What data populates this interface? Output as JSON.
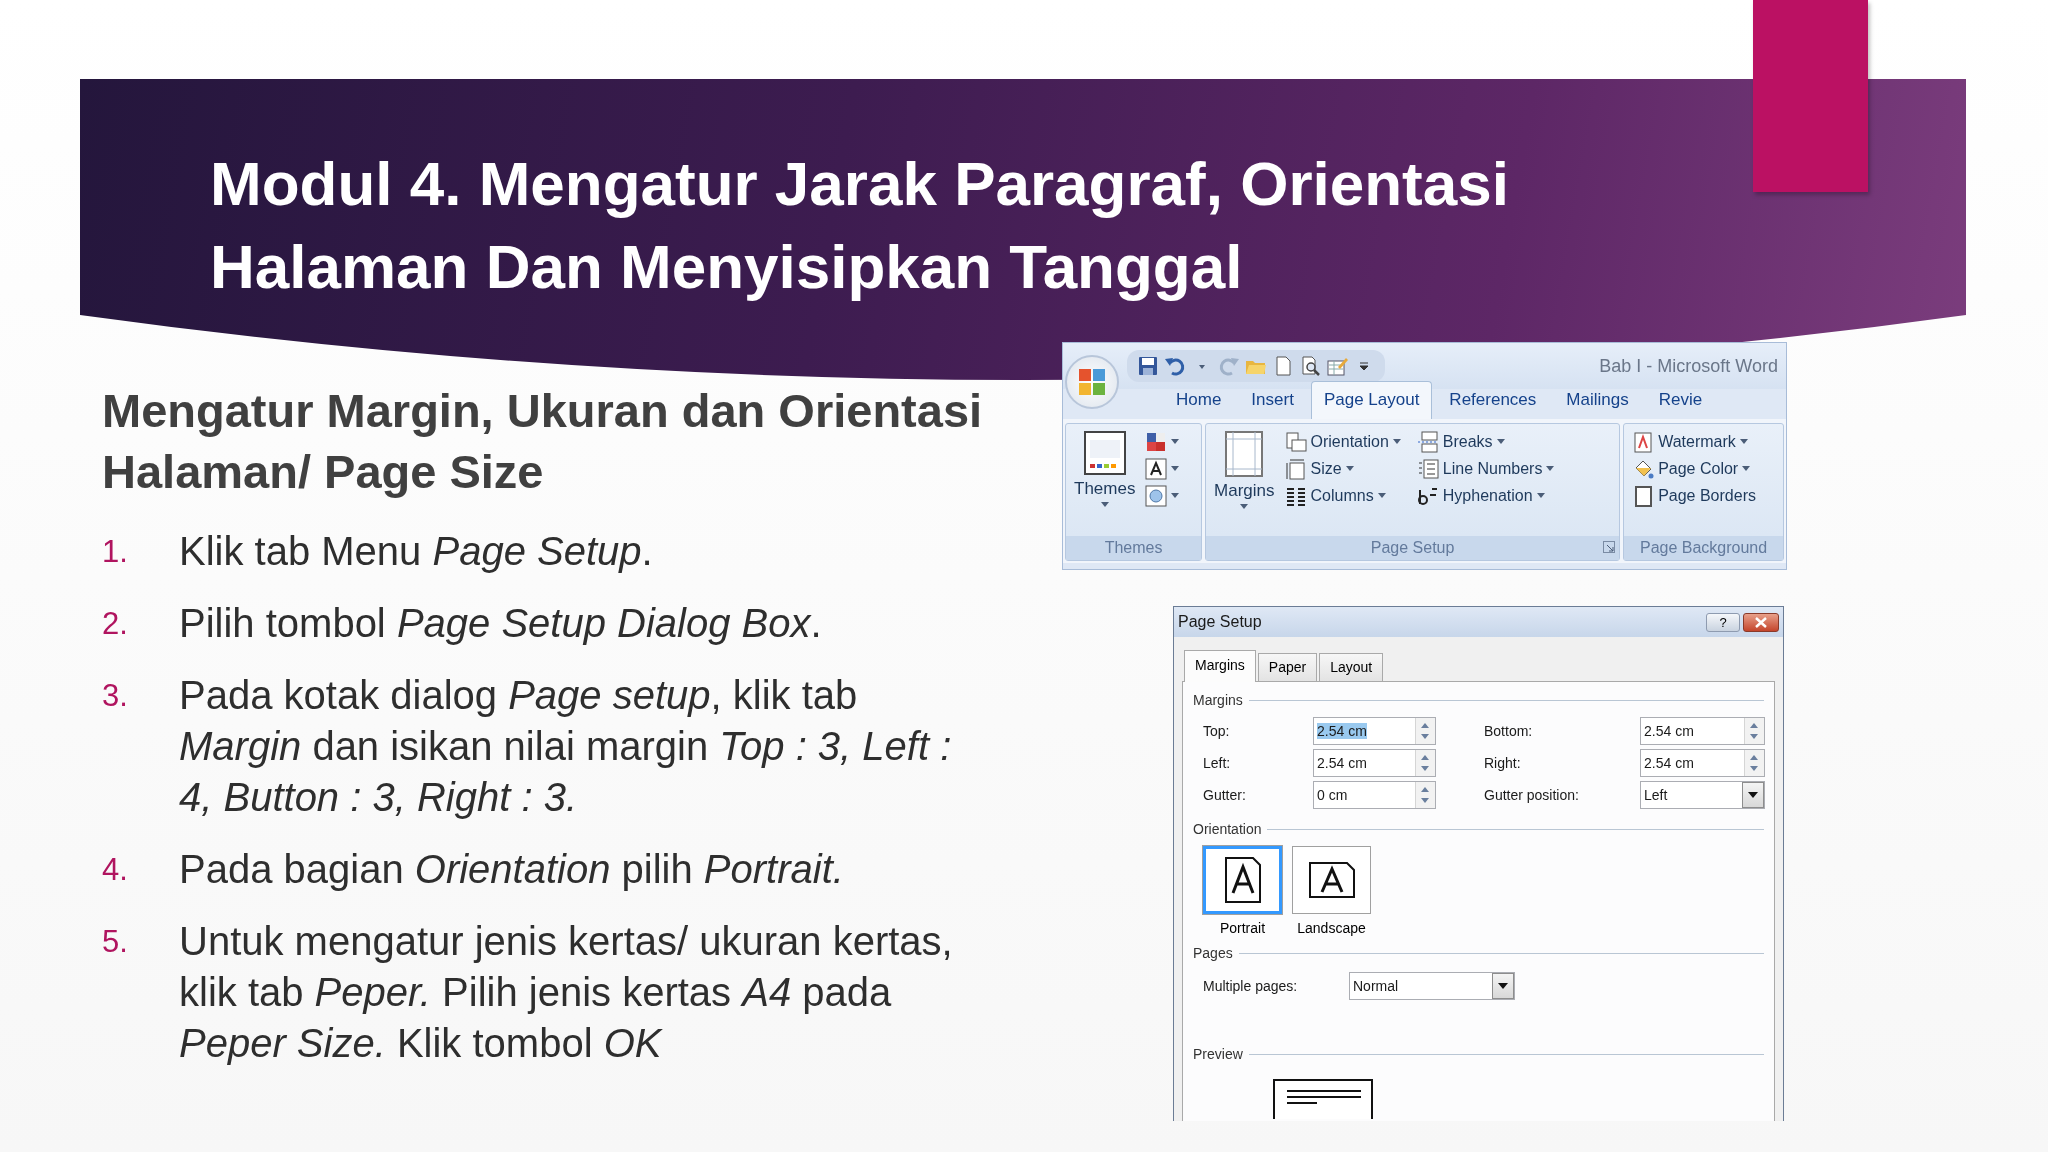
{
  "slide": {
    "title_lines": [
      "Modul 4. Mengatur Jarak Paragraf, Orientasi",
      "Halaman Dan Menyisipkan Tanggal"
    ],
    "subtitle_lines": [
      "Mengatur Margin, Ukuran dan Orientasi",
      "Halaman/ Page Size"
    ],
    "steps": [
      {
        "number": "1.",
        "lines": [
          "Klik tab Menu *Page Setup*."
        ]
      },
      {
        "number": "2.",
        "lines": [
          "Pilih tombol *Page Setup Dialog Box*."
        ]
      },
      {
        "number": "3.",
        "lines": [
          "Pada kotak dialog *Page setup*, klik tab",
          "*Margin* dan isikan nilai margin *Top : 3, Left :*",
          "*4, Button : 3, Right : 3.*"
        ]
      },
      {
        "number": "4.",
        "lines": [
          "Pada bagian *Orientation* pilih *Portrait.*"
        ]
      },
      {
        "number": "5.",
        "lines": [
          "Untuk mengatur jenis kertas/ ukuran kertas,",
          "klik tab *Peper.* Pilih jenis kertas *A4* pada",
          "*Peper Size.* Klik tombol *OK*"
        ]
      }
    ]
  },
  "ribbon": {
    "window_title": "Bab I - Microsoft Word",
    "tabs": [
      {
        "label": "Home",
        "selected": false
      },
      {
        "label": "Insert",
        "selected": false
      },
      {
        "label": "Page Layout",
        "selected": true
      },
      {
        "label": "References",
        "selected": false
      },
      {
        "label": "Mailings",
        "selected": false
      },
      {
        "label": "Revie",
        "selected": false
      }
    ],
    "groups": [
      {
        "label": "Themes",
        "launcher": false,
        "items": [
          {
            "kind": "large",
            "label": "Themes",
            "dropdown": true
          },
          {
            "kind": "icon",
            "dropdown": true
          },
          {
            "kind": "icon",
            "dropdown": true
          },
          {
            "kind": "icon",
            "dropdown": true
          }
        ]
      },
      {
        "label": "Page Setup",
        "launcher": true,
        "items": [
          {
            "kind": "large",
            "label": "Margins",
            "dropdown": true
          },
          {
            "kind": "small",
            "label": "Orientation",
            "dropdown": true
          },
          {
            "kind": "small",
            "label": "Size",
            "dropdown": true
          },
          {
            "kind": "small",
            "label": "Columns",
            "dropdown": true
          },
          {
            "kind": "small",
            "label": "Breaks",
            "dropdown": true
          },
          {
            "kind": "small",
            "label": "Line Numbers",
            "dropdown": true
          },
          {
            "kind": "small",
            "label": "Hyphenation",
            "dropdown": true
          }
        ]
      },
      {
        "label": "Page Background",
        "launcher": false,
        "items": [
          {
            "kind": "small",
            "label": "Watermark",
            "dropdown": true
          },
          {
            "kind": "small",
            "label": "Page Color",
            "dropdown": true
          },
          {
            "kind": "small",
            "label": "Page Borders",
            "dropdown": false
          }
        ]
      }
    ]
  },
  "dialog": {
    "title": "Page Setup",
    "help": "?",
    "tabs": [
      {
        "label": "Margins",
        "selected": true
      },
      {
        "label": "Paper",
        "selected": false
      },
      {
        "label": "Layout",
        "selected": false
      }
    ],
    "margins_heading": "Margins",
    "fields": [
      {
        "label": "Top:",
        "value": "2.54 cm",
        "kind": "spin",
        "highlighted": true
      },
      {
        "label": "Bottom:",
        "value": "2.54 cm",
        "kind": "spin",
        "highlighted": false
      },
      {
        "label": "Left:",
        "value": "2.54 cm",
        "kind": "spin",
        "highlighted": false
      },
      {
        "label": "Right:",
        "value": "2.54 cm",
        "kind": "spin",
        "highlighted": false
      },
      {
        "label": "Gutter:",
        "value": "0 cm",
        "kind": "spin",
        "highlighted": false
      },
      {
        "label": "Gutter position:",
        "value": "Left",
        "kind": "select",
        "highlighted": false
      }
    ],
    "orientation_heading": "Orientation",
    "orientations": [
      {
        "label": "Portrait",
        "selected": true
      },
      {
        "label": "Landscape",
        "selected": false
      }
    ],
    "pages_heading": "Pages",
    "multiple_pages": {
      "label": "Multiple pages:",
      "value": "Normal"
    },
    "preview_heading": "Preview"
  }
}
